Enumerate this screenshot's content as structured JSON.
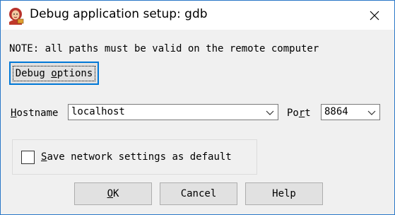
{
  "window": {
    "title": "Debug application setup: gdb"
  },
  "note": "NOTE: all paths must be valid on the remote computer",
  "debug_options": {
    "label_prefix": "Debug ",
    "label_hotkey": "o",
    "label_suffix": "ptions"
  },
  "hostname": {
    "label_hotkey": "H",
    "label_rest": "ostname",
    "value": "localhost"
  },
  "port": {
    "label_prefix": "Po",
    "label_hotkey": "r",
    "label_suffix": "t",
    "value": "8864"
  },
  "save_default": {
    "checked": false,
    "label_hotkey": "S",
    "label_rest": "ave network settings as default"
  },
  "buttons": {
    "ok_hotkey": "O",
    "ok_rest": "K",
    "cancel": "Cancel",
    "help": "Help"
  },
  "colors": {
    "accent": "#0078d7",
    "window_border": "#2b78c8",
    "button_face": "#e1e1e1",
    "dialog_bg": "#f0f0f0"
  },
  "icons": {
    "app": "gdb-app-icon",
    "close": "close-icon",
    "dropdown": "chevron-down-icon"
  }
}
